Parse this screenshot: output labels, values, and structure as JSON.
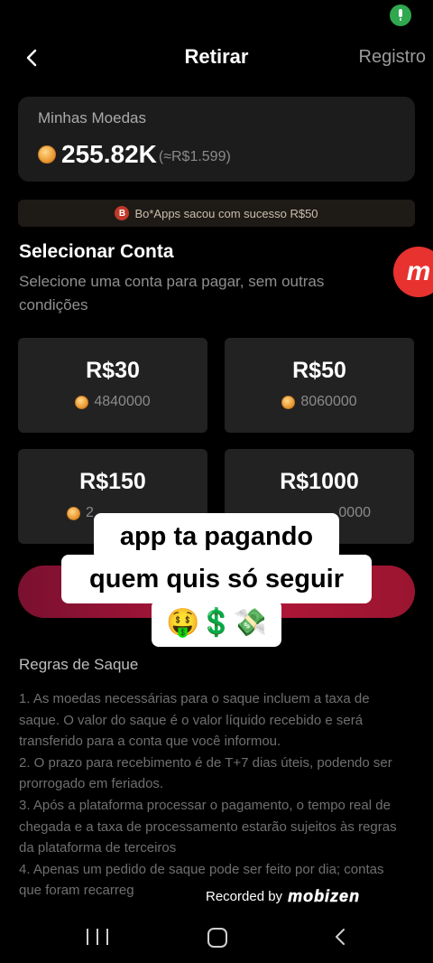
{
  "header": {
    "title": "Retirar",
    "right_link": "Registro"
  },
  "balance": {
    "label": "Minhas Moedas",
    "value": "255.82K",
    "approx": "(≈R$1.599)"
  },
  "notice": {
    "icon_letter": "B",
    "text": "Bo*Apps sacou com sucesso R$50"
  },
  "account_section": {
    "title": "Selecionar Conta",
    "description": "Selecione uma conta para pagar, sem outras condições"
  },
  "options": [
    {
      "amount": "R$30",
      "coins": "4840000"
    },
    {
      "amount": "R$50",
      "coins": "8060000"
    },
    {
      "amount": "R$150",
      "coins": "2"
    },
    {
      "amount": "R$1000",
      "coins": "0000"
    }
  ],
  "overlay_caption": {
    "line1": "app ta pagando",
    "line2": "quem quis só seguir",
    "emojis": "🤑💲💸"
  },
  "floating_logo": "m",
  "rules": {
    "title": "Regras de Saque",
    "items": [
      "1. As moedas necessárias para o saque incluem a taxa de saque. O valor do saque é o valor líquido recebido e será transferido para a conta que você informou.",
      "2. O prazo para recebimento é de T+7 dias úteis, podendo ser prorrogado em feriados.",
      "3. Após a plataforma processar o pagamento, o tempo real de chegada e a taxa de processamento estarão sujeitos às regras da plataforma de terceiros",
      "4. Apenas um pedido de saque pode ser feito por dia; contas que foram recarreg"
    ]
  },
  "watermark": {
    "text": "Recorded by",
    "brand": "mobizen"
  },
  "colors": {
    "accent_button": "#b3163a",
    "coin": "#e8932a",
    "card_bg": "#222222"
  }
}
